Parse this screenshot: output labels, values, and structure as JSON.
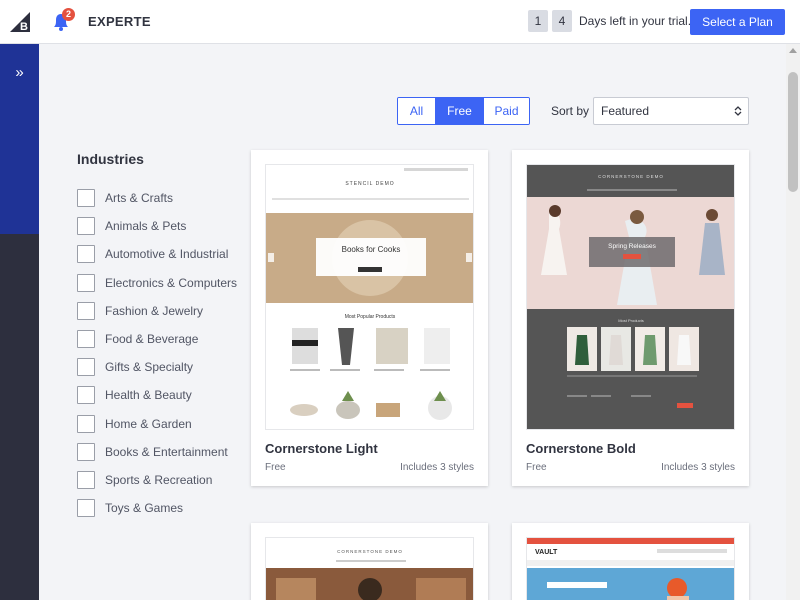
{
  "topbar": {
    "store_name": "EXPERTE",
    "notification_count": "2",
    "days_digits": [
      "1",
      "4"
    ],
    "days_text": "Days left in your trial.",
    "select_plan_label": "Select a Plan"
  },
  "nav": {
    "expand_glyph": "»"
  },
  "filters": {
    "segments": [
      "All",
      "Free",
      "Paid"
    ],
    "active_segment": "Free",
    "sort_label": "Sort by",
    "sort_value": "Featured"
  },
  "industries": {
    "title": "Industries",
    "items": [
      "Arts & Crafts",
      "Animals & Pets",
      "Automotive & Industrial",
      "Electronics & Computers",
      "Fashion & Jewelry",
      "Food & Beverage",
      "Gifts & Specialty",
      "Health & Beauty",
      "Home & Garden",
      "Books & Entertainment",
      "Sports & Recreation",
      "Toys & Games"
    ]
  },
  "themes": [
    {
      "name": "Cornerstone Light",
      "price": "Free",
      "styles": "Includes 3 styles",
      "preview": {
        "store": "STENCIL DEMO",
        "hero": "Books for Cooks",
        "section": "Most Popular Products"
      }
    },
    {
      "name": "Cornerstone Bold",
      "price": "Free",
      "styles": "Includes 3 styles",
      "preview": {
        "store": "CORNERSTONE DEMO",
        "hero": "Spring Releases",
        "section": "Most Products"
      }
    },
    {
      "name": "",
      "preview": {
        "store": "CORNERSTONE DEMO"
      }
    },
    {
      "name": "",
      "preview": {
        "store": "VAULT"
      }
    }
  ],
  "colors": {
    "accent": "#3c64f4",
    "nav_top": "#1f3396",
    "nav_bottom": "#2d2f3e",
    "badge": "#e4513f"
  }
}
